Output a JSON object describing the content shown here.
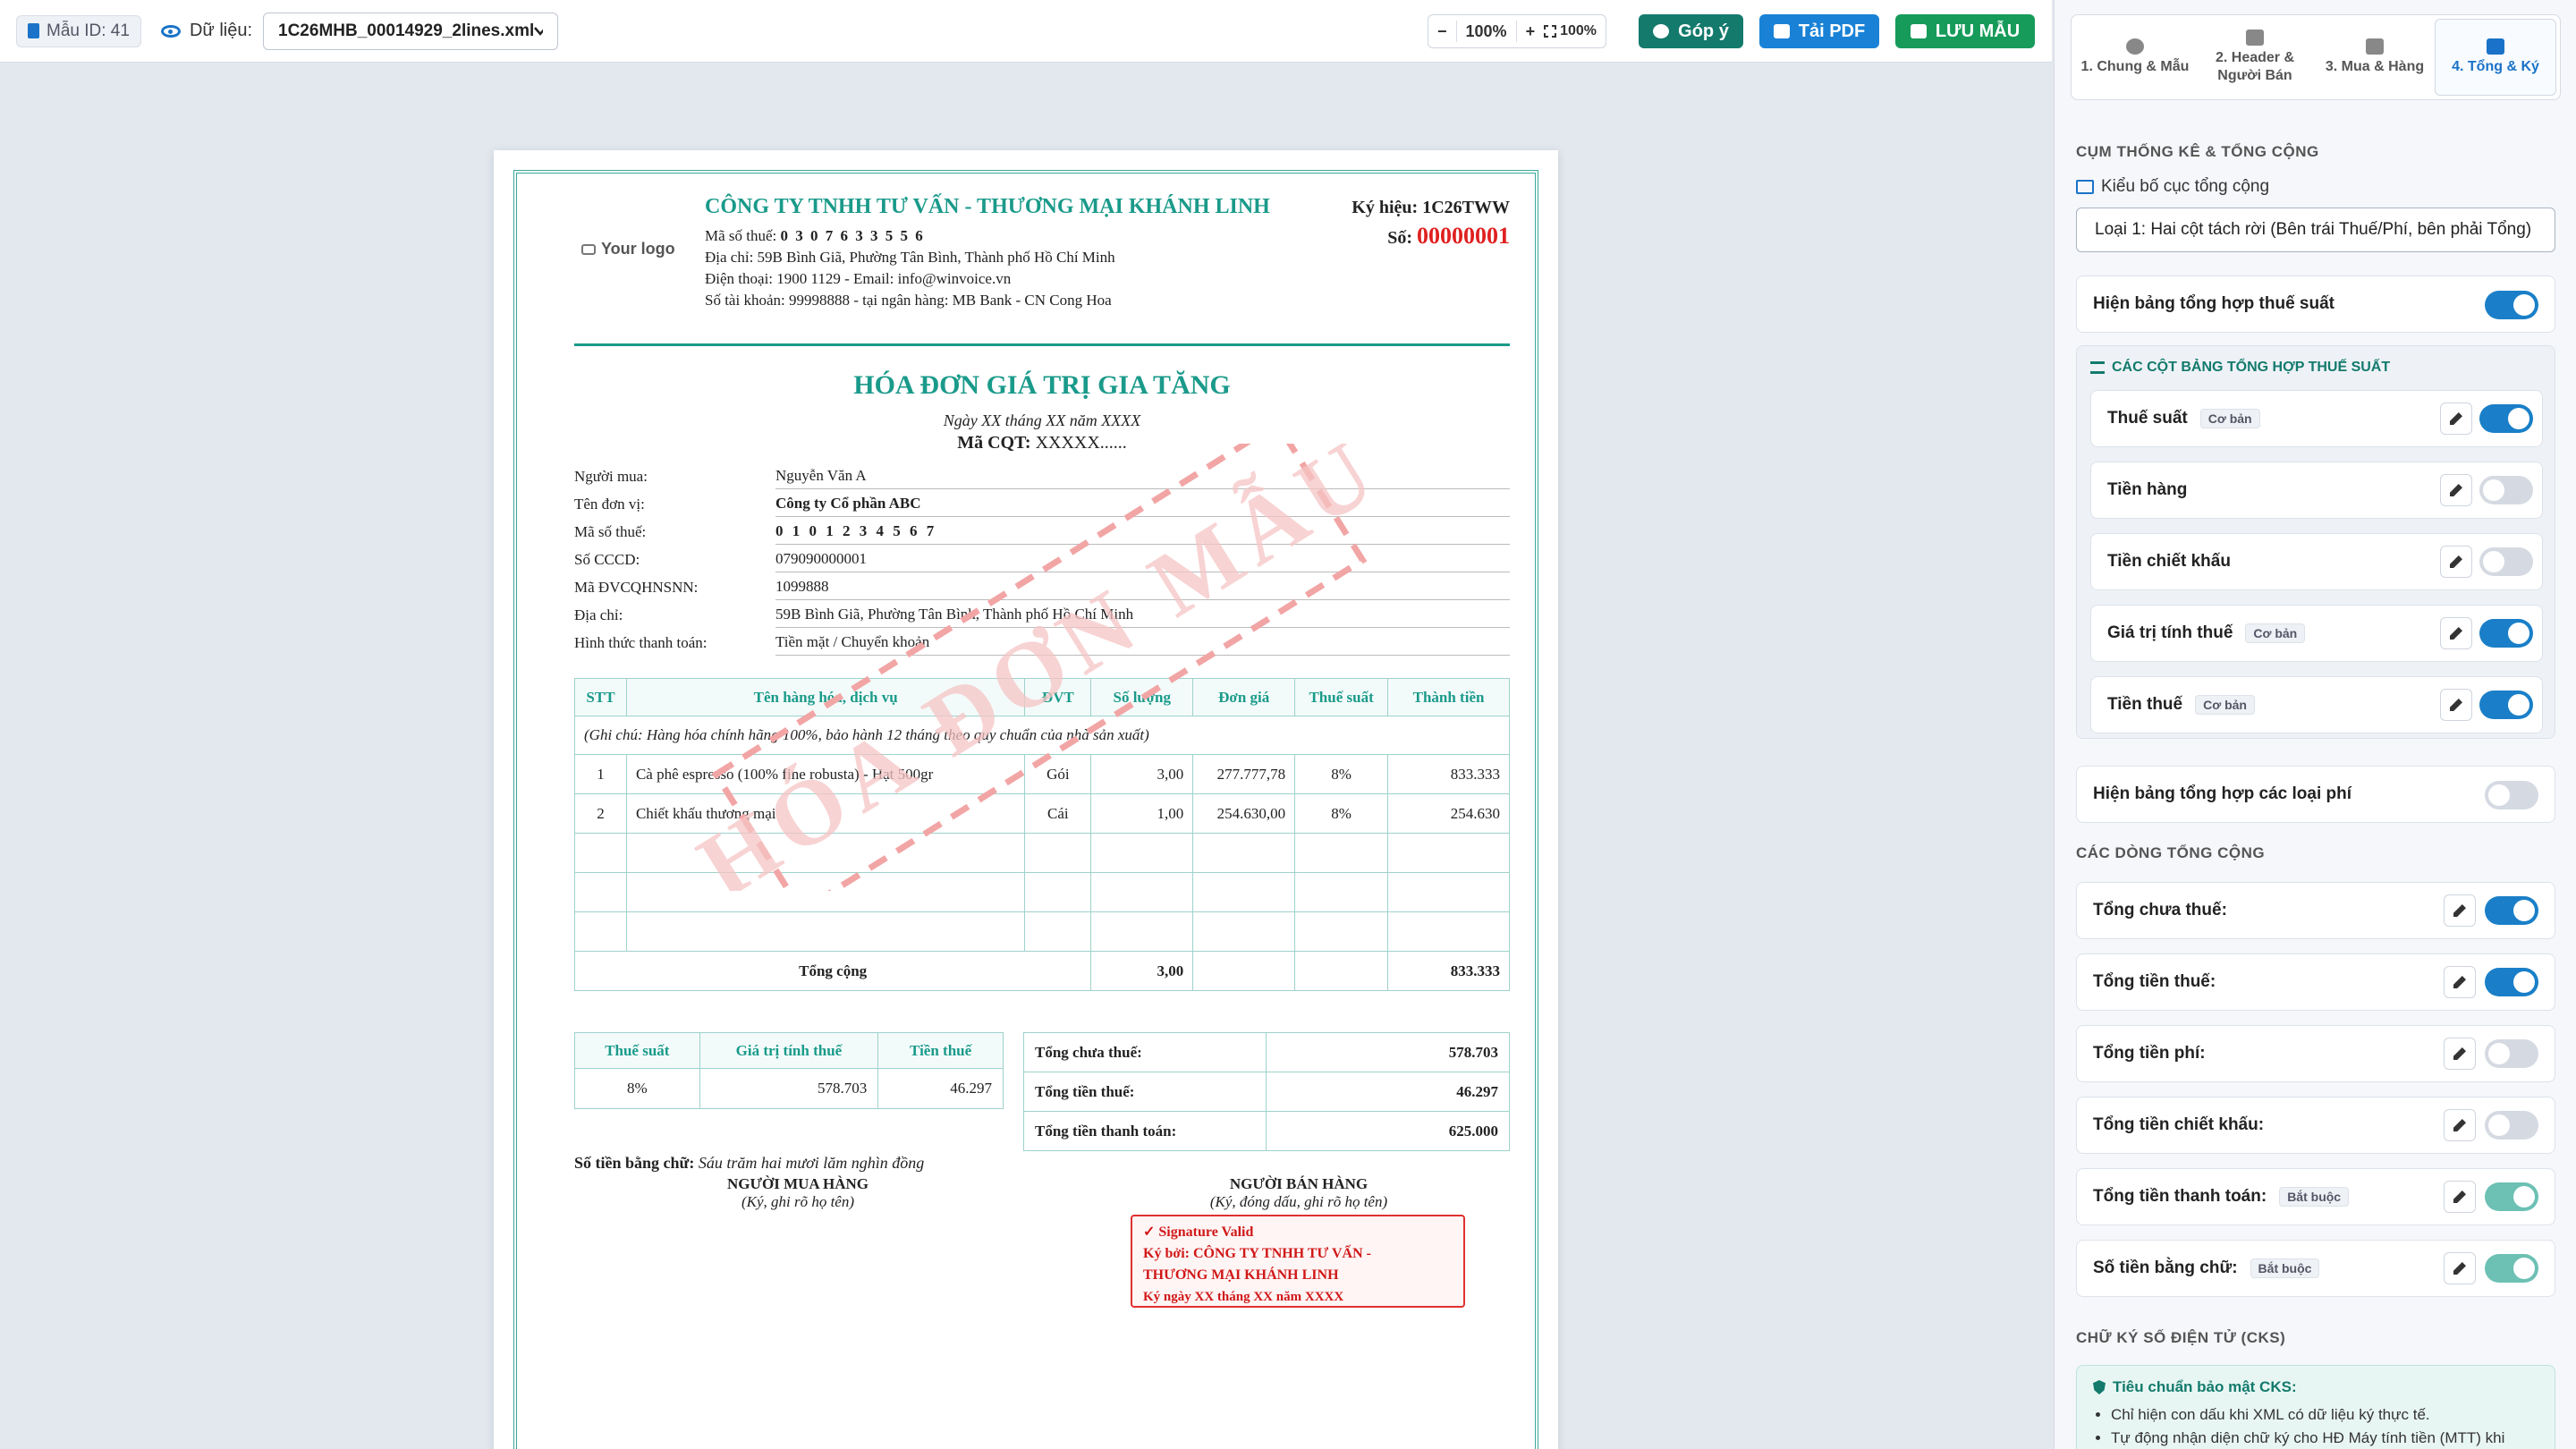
{
  "topbar": {
    "template_id": "Mẫu ID: 41",
    "data_label": "Dữ liệu:",
    "file_select": "1C26MHB_00014929_2lines.xml",
    "zoom_minus": "−",
    "zoom_level": "100%",
    "zoom_plus": "+",
    "zoom_fit": "100%",
    "feedback_button": "Góp ý",
    "pdf_button": "Tải PDF",
    "save_button": "LƯU MẪU"
  },
  "invoice": {
    "logo": "Your logo",
    "seller_name": "CÔNG TY TNHH TƯ VẤN - THƯƠNG MẠI KHÁNH LINH",
    "seller_tax_label": "Mã số thuế:",
    "seller_tax": "0 3 0 7 6 3 3 5 5 6",
    "seller_address": "Địa chỉ: 59B Bình Giã, Phường Tân Bình, Thành phố Hồ Chí Minh",
    "seller_contact": "Điện thoại: 1900 1129 - Email: info@winvoice.vn",
    "seller_bank": "Số tài khoản: 99998888 - tại ngân hàng: MB Bank - CN Cong Hoa",
    "serial_label": "Ký hiệu:",
    "serial": "1C26TWW",
    "number_label": "Số:",
    "number": "00000001",
    "title": "HÓA ĐƠN GIÁ TRỊ GIA TĂNG",
    "date": "Ngày XX tháng XX năm XXXX",
    "cqt_label": "Mã CQT:",
    "cqt": "XXXXX......",
    "buyer": [
      {
        "label": "Người mua:",
        "value": "Nguyễn Văn A"
      },
      {
        "label": "Tên đơn vị:",
        "value": "Công ty Cổ phần ABC"
      },
      {
        "label": "Mã số thuế:",
        "value": "0 1 0 1 2 3 4 5 6 7"
      },
      {
        "label": "Số CCCD:",
        "value": "079090000001"
      },
      {
        "label": "Mã ĐVCQHNSNN:",
        "value": "1099888"
      },
      {
        "label": "Địa chỉ:",
        "value": "59B Bình Giã, Phường Tân Bình, Thành phố Hồ Chí Minh"
      },
      {
        "label": "Hình thức thanh toán:",
        "value": "Tiền mặt / Chuyển khoản"
      }
    ],
    "item_headers": [
      "STT",
      "Tên hàng hóa, dịch vụ",
      "ĐVT",
      "Số lượng",
      "Đơn giá",
      "Thuế suất",
      "Thành tiền"
    ],
    "item_note": "(Ghi chú: Hàng hóa chính hãng 100%, bảo hành 12 tháng theo quy chuẩn của nhà sản xuất)",
    "items": [
      {
        "stt": "1",
        "name": "Cà phê espresso (100% fine robusta) - Hạt 500gr",
        "unit": "Gói",
        "qty": "3,00",
        "price": "277.777,78",
        "rate": "8%",
        "amount": "833.333"
      },
      {
        "stt": "2",
        "name": "Chiết khấu thương mại",
        "unit": "Cái",
        "qty": "1,00",
        "price": "254.630,00",
        "rate": "8%",
        "amount": "254.630"
      }
    ],
    "total_label": "Tổng cộng",
    "total_qty": "3,00",
    "total_amount": "833.333",
    "tax_headers": [
      "Thuế suất",
      "Giá trị tính thuế",
      "Tiền thuế"
    ],
    "tax_row": {
      "rate": "8%",
      "base": "578.703",
      "tax": "46.297"
    },
    "summary": [
      {
        "label": "Tổng chưa thuế:",
        "value": "578.703"
      },
      {
        "label": "Tổng tiền thuế:",
        "value": "46.297"
      },
      {
        "label": "Tổng tiền thanh toán:",
        "value": "625.000"
      }
    ],
    "words_label": "Số tiền bằng chữ:",
    "words": "Sáu trăm hai mươi lăm nghìn đồng",
    "buyer_sign_title": "NGƯỜI MUA HÀNG",
    "buyer_sign_note": "(Ký, ghi rõ họ tên)",
    "seller_sign_title": "NGƯỜI BÁN HÀNG",
    "seller_sign_note": "(Ký, đóng dấu, ghi rõ họ tên)",
    "sig_valid": "✓ Signature Valid",
    "sig_by": "Ký bởi: CÔNG TY TNHH TƯ VẤN -",
    "sig_by2": "THƯƠNG MẠI KHÁNH LINH",
    "sig_date": "Ký ngày XX tháng XX năm XXXX",
    "watermark": "HÓA ĐƠN MẪU"
  },
  "panel": {
    "tabs": [
      {
        "label": "1. Chung & Mẫu"
      },
      {
        "label": "2. Header & Người Bán"
      },
      {
        "label": "3. Mua & Hàng"
      },
      {
        "label": "4. Tổng & Ký"
      }
    ],
    "section_totals": "CỤM THỐNG KÊ & TỔNG CỘNG",
    "layout_label": "Kiểu bố cục tổng cộng",
    "layout_value": "Loại 1: Hai cột tách rời (Bên trái Thuế/Phí, bên phải Tổng)",
    "show_tax_summary": "Hiện bảng tổng hợp thuế suất",
    "tax_columns_title": "CÁC CỘT BẢNG TỔNG HỢP THUẾ SUẤT",
    "tax_columns": [
      {
        "label": "Thuế suất",
        "badge": "Cơ bản"
      },
      {
        "label": "Tiền hàng",
        "badge": ""
      },
      {
        "label": "Tiền chiết khấu",
        "badge": ""
      },
      {
        "label": "Giá trị tính thuế",
        "badge": "Cơ bản"
      },
      {
        "label": "Tiền thuế",
        "badge": "Cơ bản"
      }
    ],
    "show_fee_summary": "Hiện bảng tổng hợp các loại phí",
    "section_total_lines": "CÁC DÒNG TỔNG CỘNG",
    "total_lines": [
      {
        "label": "Tổng chưa thuế:",
        "badge": ""
      },
      {
        "label": "Tổng tiền thuế:",
        "badge": ""
      },
      {
        "label": "Tổng tiền phí:",
        "badge": ""
      },
      {
        "label": "Tổng tiền chiết khấu:",
        "badge": ""
      },
      {
        "label": "Tổng tiền thanh toán:",
        "badge": "Bắt buộc"
      },
      {
        "label": "Số tiền bằng chữ:",
        "badge": "Bắt buộc"
      }
    ],
    "section_signature": "CHỮ KÝ SỐ ĐIỆN TỬ (CKS)",
    "security_title": "Tiêu chuẩn bảo mật CKS:",
    "security_items": [
      "Chỉ hiện con dấu khi XML có dữ liệu ký thực tế.",
      "Tự động nhận diện chữ ký cho HĐ Máy tính tiền (MTT) khi"
    ]
  },
  "colors": {
    "accent": "#1a9a8a",
    "primary": "#1a73c8",
    "danger": "#e02020",
    "save": "#169b5a"
  }
}
